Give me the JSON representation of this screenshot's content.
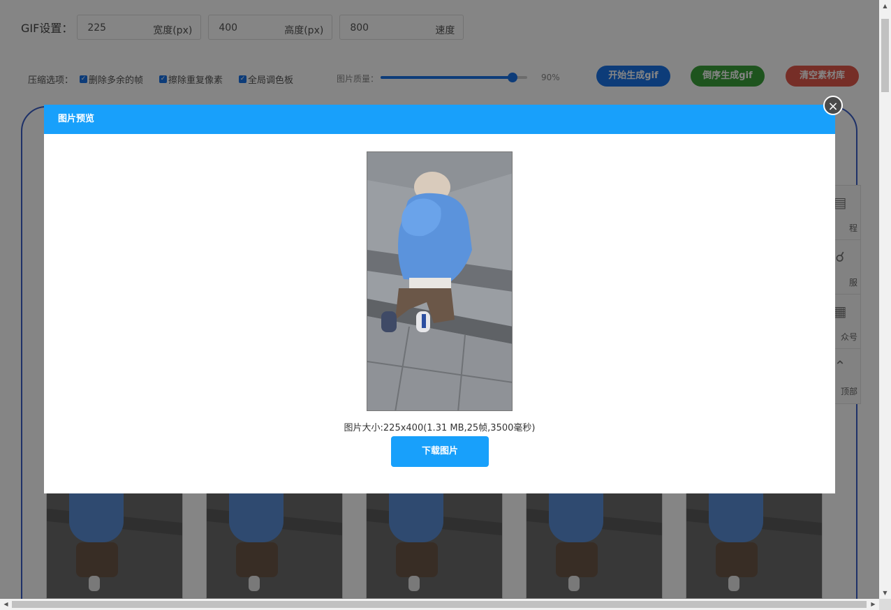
{
  "settings": {
    "gif_label": "GIF设置：",
    "width": {
      "value": "225",
      "unit": "宽度(px)"
    },
    "height": {
      "value": "400",
      "unit": "高度(px)"
    },
    "speed": {
      "value": "800",
      "unit": "速度"
    }
  },
  "compress": {
    "label": "压缩选项：",
    "options": [
      {
        "label": "删除多余的帧",
        "checked": true
      },
      {
        "label": "擦除重复像素",
        "checked": true
      },
      {
        "label": "全局调色板",
        "checked": true
      }
    ],
    "quality_label": "图片质量：",
    "quality": 0.9,
    "quality_text": "90%"
  },
  "actions": {
    "start": "开始生成gif",
    "reverse": "倒序生成gif",
    "clear": "清空素材库"
  },
  "sidebar": {
    "items": [
      {
        "label": "教程",
        "visible_text": "程",
        "icon": "document-icon"
      },
      {
        "label": "客服",
        "visible_text": "服",
        "icon": "headset-icon"
      },
      {
        "label": "公众号",
        "visible_text": "众号",
        "icon": "qrcode-icon"
      },
      {
        "label": "回到顶部",
        "visible_text": "顶部",
        "icon": "chevron-up-icon"
      }
    ]
  },
  "modal": {
    "title": "图片预览",
    "close": "×",
    "info": "图片大小:225x400(1.31 MB,25帧,3500毫秒)",
    "download": "下载图片"
  },
  "colors": {
    "accent": "#18a0fb",
    "start": "#1a73e8",
    "reverse": "#3aa23a",
    "clear": "#e3584b"
  }
}
